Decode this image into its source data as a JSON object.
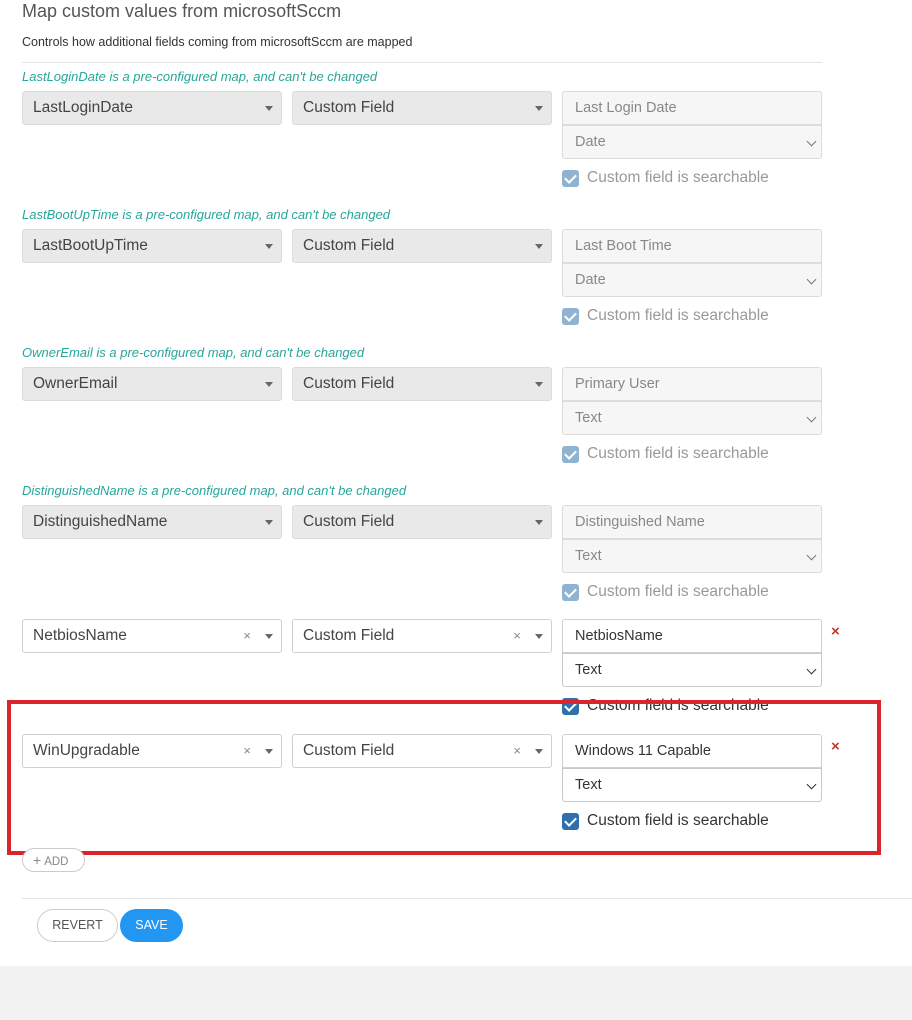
{
  "header": {
    "title": "Map custom values from microsoftSccm",
    "description": "Controls how additional fields coming from microsoftSccm are mapped"
  },
  "mappings": [
    {
      "note": "LastLoginDate is a pre-configured map, and can't be changed",
      "source": "LastLoginDate",
      "target": "Custom Field",
      "field_name": "Last Login Date",
      "field_type": "Date",
      "searchable_label": "Custom field is searchable",
      "searchable": true,
      "editable": false
    },
    {
      "note": "LastBootUpTime is a pre-configured map, and can't be changed",
      "source": "LastBootUpTime",
      "target": "Custom Field",
      "field_name": "Last Boot Time",
      "field_type": "Date",
      "searchable_label": "Custom field is searchable",
      "searchable": true,
      "editable": false
    },
    {
      "note": "OwnerEmail is a pre-configured map, and can't be changed",
      "source": "OwnerEmail",
      "target": "Custom Field",
      "field_name": "Primary User",
      "field_type": "Text",
      "searchable_label": "Custom field is searchable",
      "searchable": true,
      "editable": false
    },
    {
      "note": "DistinguishedName is a pre-configured map, and can't be changed",
      "source": "DistinguishedName",
      "target": "Custom Field",
      "field_name": "Distinguished Name",
      "field_type": "Text",
      "searchable_label": "Custom field is searchable",
      "searchable": true,
      "editable": false
    },
    {
      "source": "NetbiosName",
      "target": "Custom Field",
      "field_name": "NetbiosName",
      "field_type": "Text",
      "searchable_label": "Custom field is searchable",
      "searchable": true,
      "editable": true,
      "clear_icon": "×",
      "delete_icon": "×"
    },
    {
      "source": "WinUpgradable",
      "target": "Custom Field",
      "field_name": "Windows 11 Capable",
      "field_type": "Text",
      "searchable_label": "Custom field is searchable",
      "searchable": true,
      "editable": true,
      "clear_icon": "×",
      "delete_icon": "×"
    }
  ],
  "actions": {
    "add_label": "ADD",
    "add_icon": "+",
    "revert_label": "REVERT",
    "save_label": "SAVE"
  },
  "colors": {
    "note_text": "#26a69a",
    "save_button": "#2196f3",
    "highlight_box": "#d9262c",
    "delete_icon": "#c0392b",
    "checkbox_active": "#2f6fab"
  }
}
